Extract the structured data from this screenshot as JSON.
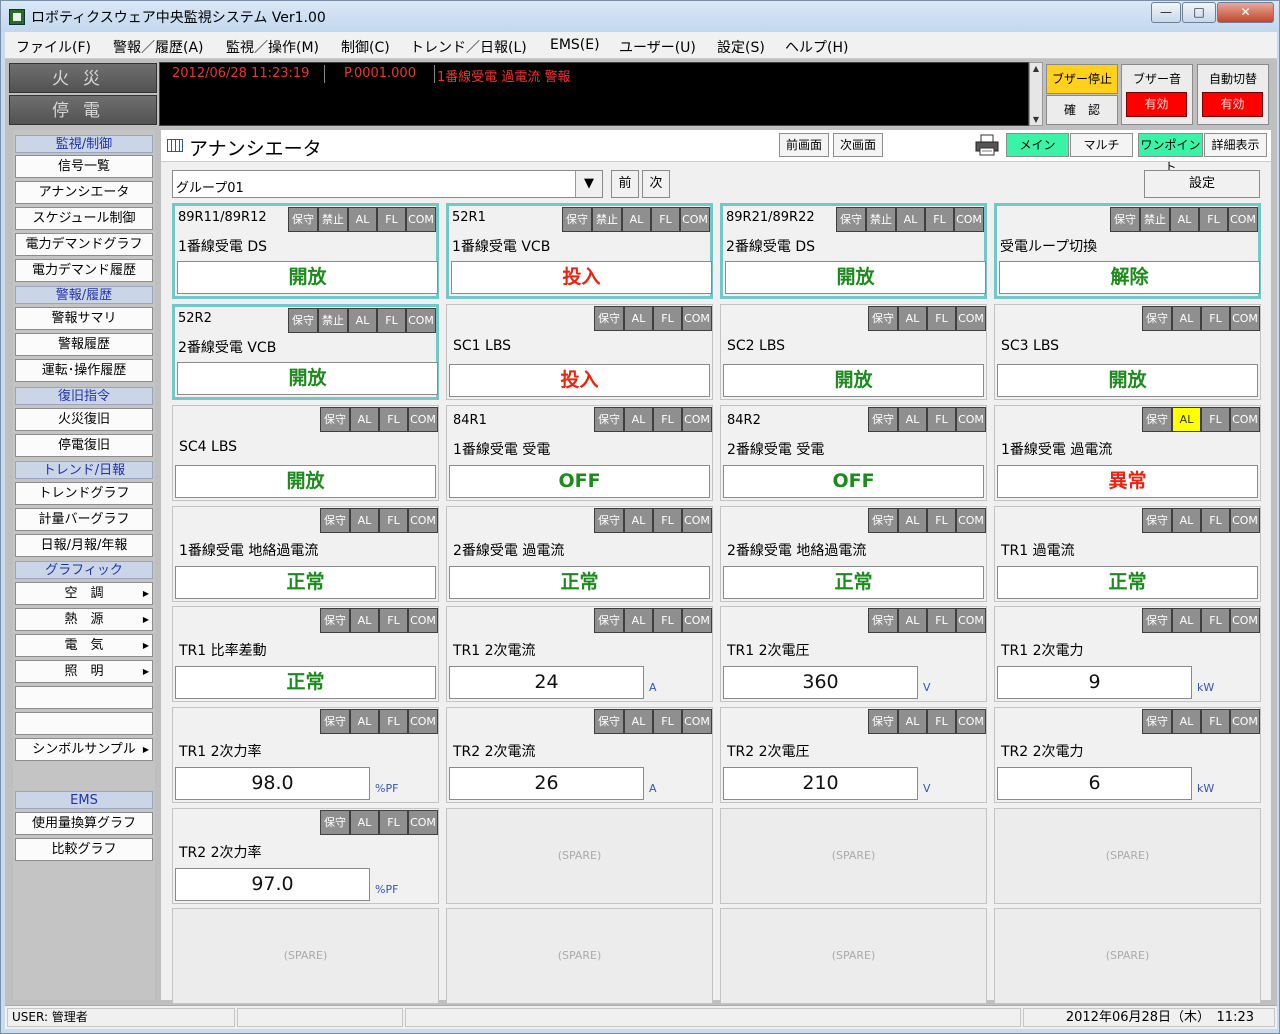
{
  "window": {
    "title": "ロボティクスウェア中央監視システム Ver1.00",
    "min": "—",
    "max": "□",
    "close": "✕"
  },
  "menu": [
    "ファイル(F)",
    "警報／履歴(A)",
    "監視／操作(M)",
    "制御(C)",
    "トレンド／日報(L)",
    "EMS(E)",
    "ユーザー(U)",
    "設定(S)",
    "ヘルプ(H)"
  ],
  "alarm_buttons": {
    "fire": "火災",
    "power": "停電"
  },
  "message": {
    "datetime": "2012/06/28 11:23:19",
    "point": "P.0001.000",
    "text": "1番線受電 過電流 警報"
  },
  "top_buttons": {
    "buzzer_stop": "ブザー停止",
    "confirm": "確　認",
    "buzzer_sound": "ブザー音",
    "buzzer_enabled": "有効",
    "auto_switch": "自動切替",
    "auto_enabled": "有効"
  },
  "sidebar": {
    "monitor_head": "監視/制御",
    "monitor": [
      "信号一覧",
      "アナンシエータ",
      "スケジュール制御",
      "電力デマンドグラフ",
      "電力デマンド履歴"
    ],
    "alarm_head": "警報/履歴",
    "alarm": [
      "警報サマリ",
      "警報履歴",
      "運転･操作履歴"
    ],
    "recover_head": "復旧指令",
    "recover": [
      "火災復旧",
      "停電復旧"
    ],
    "trend_head": "トレンド/日報",
    "trend": [
      "トレンドグラフ",
      "計量バーグラフ",
      "日報/月報/年報"
    ],
    "graphic_head": "グラフィック",
    "graphic": [
      "空　調",
      "熱　源",
      "電　気",
      "照　明"
    ],
    "symbol": "シンボルサンプル",
    "ems_head": "EMS",
    "ems": [
      "使用量換算グラフ",
      "比較グラフ"
    ]
  },
  "header": {
    "title": "アナンシエータ",
    "prev_screen": "前画面",
    "next_screen": "次画面",
    "main": "メイン",
    "multi": "マルチ",
    "onepoint": "ワンポイント",
    "detail": "詳細表示"
  },
  "group": {
    "value": "グループ01",
    "prev": "前",
    "next": "次",
    "settings": "設定"
  },
  "flags": {
    "maint": "保守",
    "inhibit": "禁止",
    "al": "AL",
    "fl": "FL",
    "com": "COM"
  },
  "panels": [
    {
      "tag": "89R11/89R12",
      "name": "1番線受電 DS",
      "value": "開放"
    },
    {
      "tag": "52R1",
      "name": "1番線受電 VCB",
      "value": "投入"
    },
    {
      "tag": "89R21/89R22",
      "name": "2番線受電 DS",
      "value": "開放"
    },
    {
      "tag": "",
      "name": "受電ループ切換",
      "value": "解除"
    },
    {
      "tag": "52R2",
      "name": "2番線受電 VCB",
      "value": "開放"
    },
    {
      "tag": "",
      "name": "SC1 LBS",
      "value": "投入"
    },
    {
      "tag": "",
      "name": "SC2 LBS",
      "value": "開放"
    },
    {
      "tag": "",
      "name": "SC3 LBS",
      "value": "開放"
    },
    {
      "tag": "",
      "name": "SC4 LBS",
      "value": "開放"
    },
    {
      "tag": "84R1",
      "name": "1番線受電 受電",
      "value": "OFF"
    },
    {
      "tag": "84R2",
      "name": "2番線受電 受電",
      "value": "OFF"
    },
    {
      "tag": "",
      "name": "1番線受電 過電流",
      "value": "異常"
    },
    {
      "tag": "",
      "name": "1番線受電 地絡過電流",
      "value": "正常"
    },
    {
      "tag": "",
      "name": "2番線受電 過電流",
      "value": "正常"
    },
    {
      "tag": "",
      "name": "2番線受電 地絡過電流",
      "value": "正常"
    },
    {
      "tag": "",
      "name": "TR1 過電流",
      "value": "正常"
    },
    {
      "tag": "",
      "name": "TR1 比率差動",
      "value": "正常"
    },
    {
      "tag": "",
      "name": "TR1 2次電流",
      "value": "24",
      "unit": "A"
    },
    {
      "tag": "",
      "name": "TR1 2次電圧",
      "value": "360",
      "unit": "V"
    },
    {
      "tag": "",
      "name": "TR1 2次電力",
      "value": "9",
      "unit": "kW"
    },
    {
      "tag": "",
      "name": "TR1 2次力率",
      "value": "98.0",
      "unit": "%PF"
    },
    {
      "tag": "",
      "name": "TR2 2次電流",
      "value": "26",
      "unit": "A"
    },
    {
      "tag": "",
      "name": "TR2 2次電圧",
      "value": "210",
      "unit": "V"
    },
    {
      "tag": "",
      "name": "TR2 2次電力",
      "value": "6",
      "unit": "kW"
    },
    {
      "tag": "",
      "name": "TR2 2次力率",
      "value": "97.0",
      "unit": "%PF"
    }
  ],
  "spare": "(SPARE)",
  "status": {
    "user": "USER: 管理者",
    "datetime": "2012年06月28日（木）　11:23"
  }
}
